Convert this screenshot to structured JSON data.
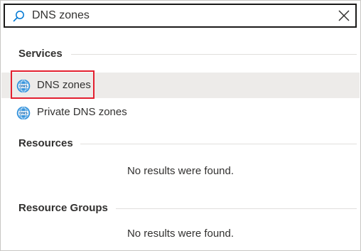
{
  "search": {
    "value": "DNS zones",
    "placeholder": ""
  },
  "sections": {
    "services": {
      "title": "Services",
      "items": [
        {
          "label": "DNS zones",
          "icon": "dns-zone-icon",
          "selected": true
        },
        {
          "label": "Private DNS zones",
          "icon": "dns-zone-icon",
          "selected": false
        }
      ]
    },
    "resources": {
      "title": "Resources",
      "empty_text": "No results were found."
    },
    "resource_groups": {
      "title": "Resource Groups",
      "empty_text": "No results were found."
    }
  },
  "colors": {
    "highlight": "#e3202f",
    "selected_row": "#edebe9",
    "icon_blue": "#3a96dd"
  }
}
